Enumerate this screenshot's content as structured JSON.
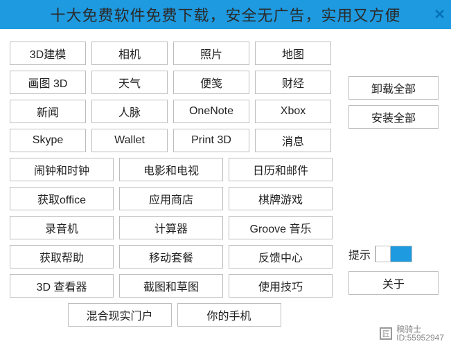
{
  "banner": {
    "text": "十大免费软件免费下载，安全无广告，实用又方便",
    "close": "✕"
  },
  "grid": {
    "rows4": [
      [
        "3D建模",
        "相机",
        "照片",
        "地图"
      ],
      [
        "画图 3D",
        "天气",
        "便笺",
        "财经"
      ],
      [
        "新闻",
        "人脉",
        "OneNote",
        "Xbox"
      ],
      [
        "Skype",
        "Wallet",
        "Print 3D",
        "消息"
      ]
    ],
    "rows3": [
      [
        "闹钟和时钟",
        "电影和电视",
        "日历和邮件"
      ],
      [
        "获取office",
        "应用商店",
        "棋牌游戏"
      ],
      [
        "录音机",
        "计算器",
        "Groove 音乐"
      ],
      [
        "获取帮助",
        "移动套餐",
        "反馈中心"
      ],
      [
        "3D 查看器",
        "截图和草图",
        "使用技巧"
      ]
    ],
    "rowsLast": [
      "混合现实门户",
      "你的手机"
    ]
  },
  "side": {
    "uninstall": "卸载全部",
    "install": "安装全部",
    "toggleLabel": "提示",
    "about": "关于"
  },
  "watermark": {
    "brand": "稿骑士",
    "id": "ID:55952947"
  }
}
